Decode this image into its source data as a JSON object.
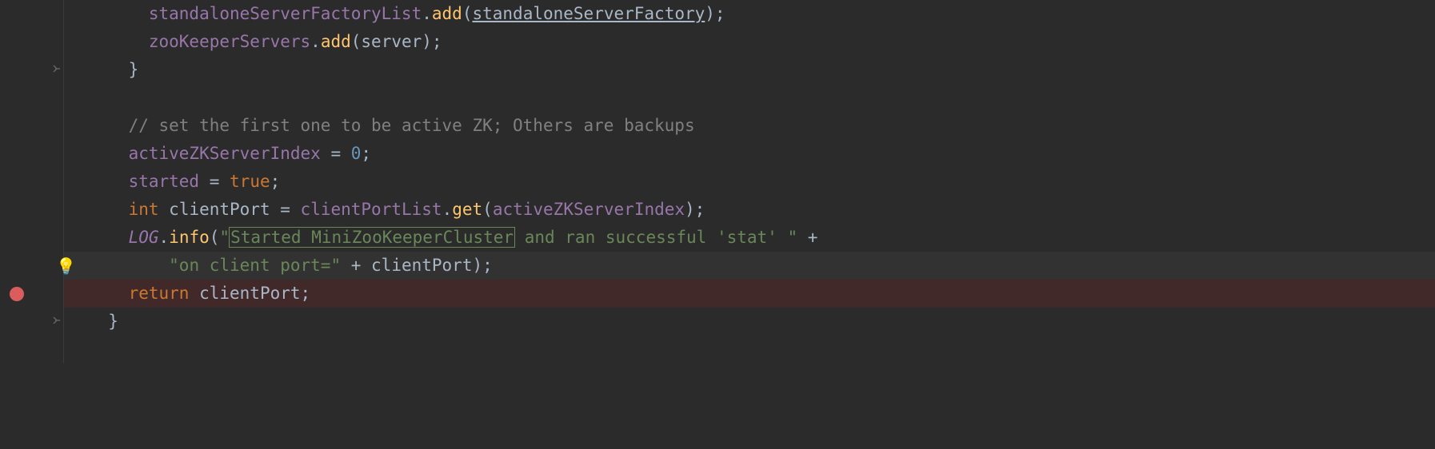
{
  "code": {
    "line1": {
      "indent": "      ",
      "field1": "standaloneServerFactoryList",
      "punct1": ".",
      "method1": "add",
      "punct2": "(",
      "param1": "standaloneServerFactory",
      "punct3": ");"
    },
    "line2": {
      "indent": "      ",
      "field1": "zooKeeperServers",
      "punct1": ".",
      "method1": "add",
      "punct2": "(",
      "param1": "server",
      "punct3": ");"
    },
    "line3": {
      "indent": "    ",
      "brace": "}"
    },
    "line4": {
      "indent": ""
    },
    "line5": {
      "indent": "    ",
      "comment": "// set the first one to be active ZK; Others are backups"
    },
    "line6": {
      "indent": "    ",
      "field1": "activeZKServerIndex",
      "punct1": " = ",
      "num": "0",
      "punct2": ";"
    },
    "line7": {
      "indent": "    ",
      "field1": "started",
      "punct1": " = ",
      "kw": "true",
      "punct2": ";"
    },
    "line8": {
      "indent": "    ",
      "kw": "int",
      "space1": " ",
      "var": "clientPort",
      "punct1": " = ",
      "field1": "clientPortList",
      "punct2": ".",
      "method1": "get",
      "punct3": "(",
      "field2": "activeZKServerIndex",
      "punct4": ");"
    },
    "line9": {
      "indent": "    ",
      "field1": "LOG",
      "punct1": ".",
      "method1": "info",
      "punct2": "(",
      "str1": "\"",
      "highlighted": "Started MiniZooKeeperCluster",
      "str2": " and ran successful 'stat' \"",
      "punct3": " +"
    },
    "line10": {
      "indent": "        ",
      "str1": "\"on client port=\"",
      "punct1": " + ",
      "var": "clientPort",
      "punct2": ");"
    },
    "line11": {
      "indent": "    ",
      "kw": "return",
      "space1": " ",
      "var": "clientPort",
      "punct1": ";"
    },
    "line12": {
      "indent": "  ",
      "brace": "}"
    },
    "line13": {
      "indent": ""
    }
  },
  "icons": {
    "bulb": "💡"
  }
}
